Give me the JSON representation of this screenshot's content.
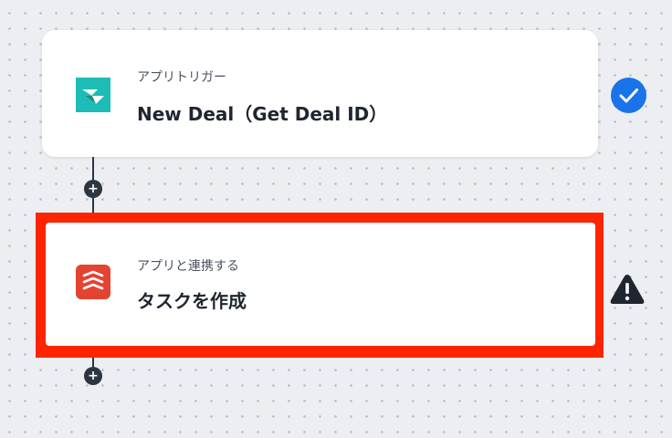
{
  "flow": {
    "trigger": {
      "sub": "アプリトリガー",
      "title": "New Deal（Get Deal ID）",
      "icon": "deal-app-logo-icon",
      "status_icon": "check-circle-icon",
      "status_color": "#1a73e8"
    },
    "action": {
      "sub": "アプリと連携する",
      "title": "タスクを作成",
      "icon": "todoist-logo-icon",
      "status_icon": "warning-triangle-icon",
      "highlight_color": "#ff2400"
    },
    "add_nodes": [
      "+",
      "+"
    ]
  },
  "colors": {
    "trigger_brand": "#1ebcb6",
    "action_brand": "#e44332",
    "connector": "#2d3540"
  }
}
